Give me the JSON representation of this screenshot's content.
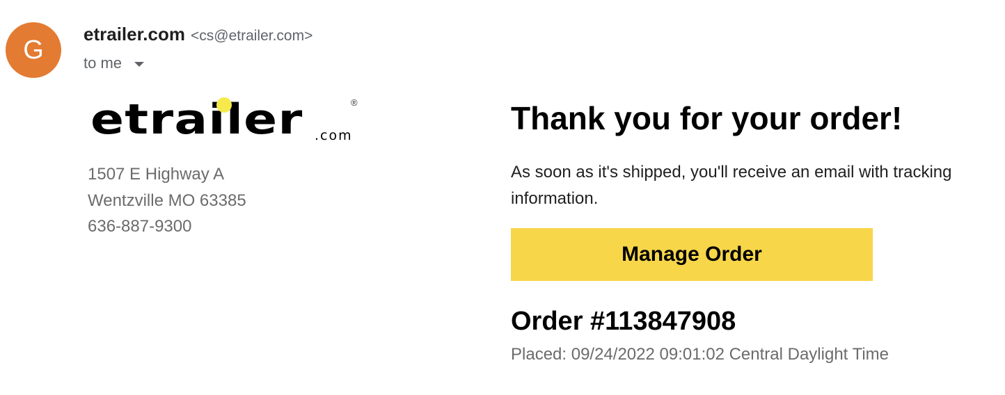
{
  "email": {
    "avatar_letter": "G",
    "avatar_color": "#e37b32",
    "sender_name": "etrailer.com",
    "sender_email": "<cs@etrailer.com>",
    "recipient_label": "to me",
    "recipient_icon": "chevron-down-icon"
  },
  "logo": {
    "wordmark": "etrailer",
    "suffix": ".com",
    "registered_mark": "®",
    "dot_color": "#f5e94b"
  },
  "address": {
    "street": "1507 E Highway A",
    "city_state_zip": "Wentzville MO 63385",
    "phone": "636-887-9300"
  },
  "order": {
    "headline": "Thank you for your order!",
    "message": "As soon as it's shipped, you'll receive an email with tracking information.",
    "manage_button_label": "Manage Order",
    "manage_button_color": "#f7d64a",
    "order_number": "Order #113847908",
    "placed": "Placed: 09/24/2022 09:01:02 Central Daylight Time"
  }
}
